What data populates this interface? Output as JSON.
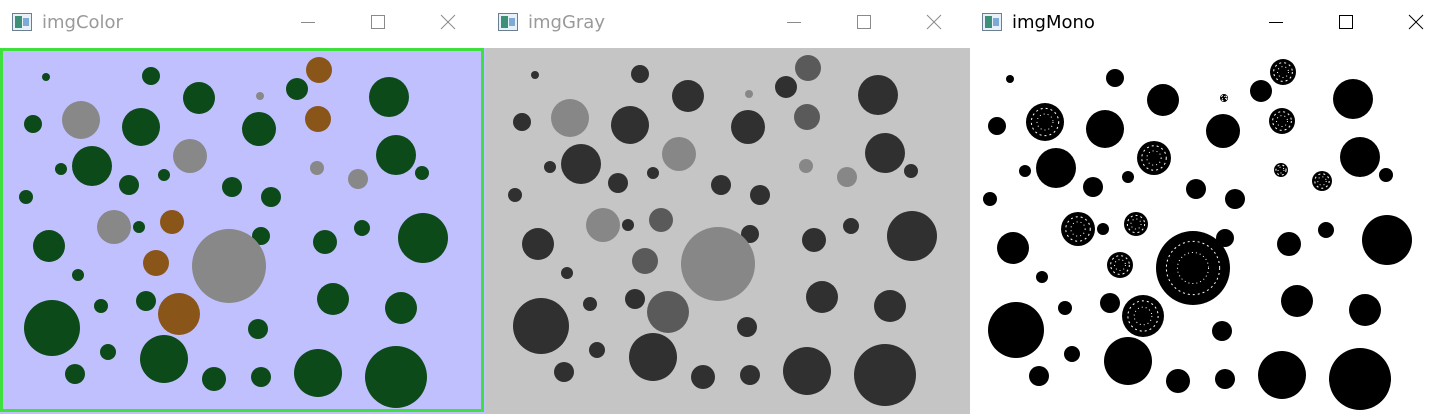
{
  "windows": [
    {
      "title": "imgColor",
      "active": false,
      "background": "#c0c0ff",
      "frame_accent": "#3ee03e",
      "icons": [
        "window-icon",
        "minimize-icon",
        "maximize-icon",
        "close-icon"
      ]
    },
    {
      "title": "imgGray",
      "active": false,
      "background": "#c5c5c5",
      "icons": [
        "window-icon",
        "minimize-icon",
        "maximize-icon",
        "close-icon"
      ]
    },
    {
      "title": "imgMono",
      "active": true,
      "background": "#ffffff",
      "icons": [
        "window-icon",
        "minimize-icon",
        "maximize-icon",
        "close-icon"
      ]
    }
  ],
  "image_colors": {
    "dark_green": "#0d4a1a",
    "gray": "#888888",
    "brown": "#8a5518",
    "gray_dark": "#303030",
    "gray_mid": "#5a5a5a",
    "gray_light": "#878787",
    "mono_fill": "#000000"
  }
}
